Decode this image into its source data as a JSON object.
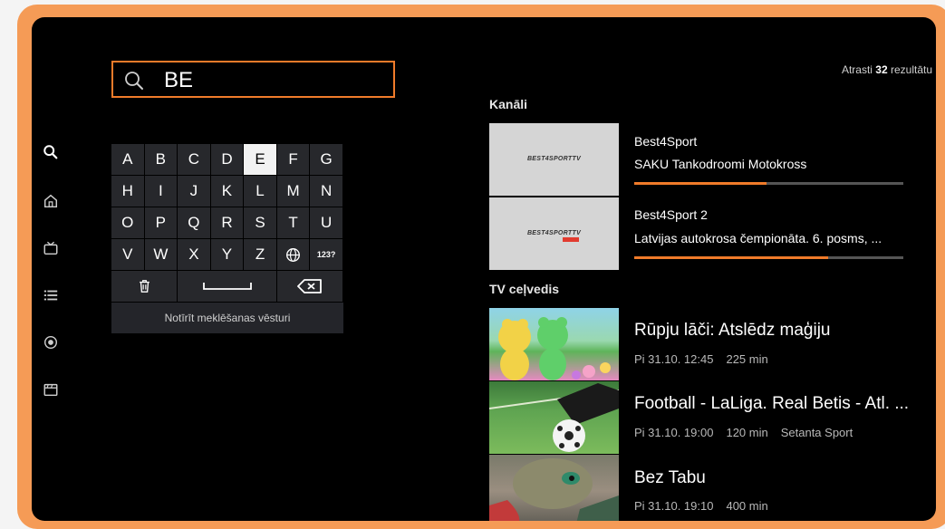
{
  "search": {
    "query": "BE"
  },
  "keyboard": {
    "rows": [
      [
        "A",
        "B",
        "C",
        "D",
        "E",
        "F",
        "G"
      ],
      [
        "H",
        "I",
        "J",
        "K",
        "L",
        "M",
        "N"
      ],
      [
        "O",
        "P",
        "Q",
        "R",
        "S",
        "T",
        "U"
      ],
      [
        "V",
        "W",
        "X",
        "Y",
        "Z",
        "🌐",
        "123?"
      ]
    ],
    "active_key": "E",
    "clear_history": "Notīrīt meklēšanas vēsturi"
  },
  "results": {
    "count_prefix": "Atrasti ",
    "count": "32",
    "count_suffix": " rezultātu"
  },
  "channels_section": {
    "title": "Kanāli",
    "items": [
      {
        "name": "Best4Sport",
        "program": "SAKU Tankodroomi Motokross",
        "logo": "BEST4SPORTTV",
        "progress": 0.49
      },
      {
        "name": "Best4Sport 2",
        "program": "Latvijas autokrosa čempionāta. 6. posms, ...",
        "logo": "BEST4SPORTTV",
        "progress": 0.72
      }
    ]
  },
  "guide_section": {
    "title": "TV ceļvedis",
    "items": [
      {
        "title": "Rūpju lāči: Atslēdz maģiju",
        "date": "Pi 31.10. 12:45",
        "duration": "225 min",
        "channel": ""
      },
      {
        "title": "Football - LaLiga. Real Betis - Atl. ...",
        "date": "Pi 31.10. 19:00",
        "duration": "120 min",
        "channel": "Setanta Sport"
      },
      {
        "title": "Bez Tabu",
        "date": "Pi 31.10. 19:10",
        "duration": "400 min",
        "channel": ""
      }
    ]
  },
  "colors": {
    "accent": "#f07b2a",
    "frame": "#f59b56"
  },
  "icons": [
    "search-icon",
    "home-icon",
    "tv-icon",
    "list-icon",
    "record-icon",
    "clapper-icon"
  ]
}
